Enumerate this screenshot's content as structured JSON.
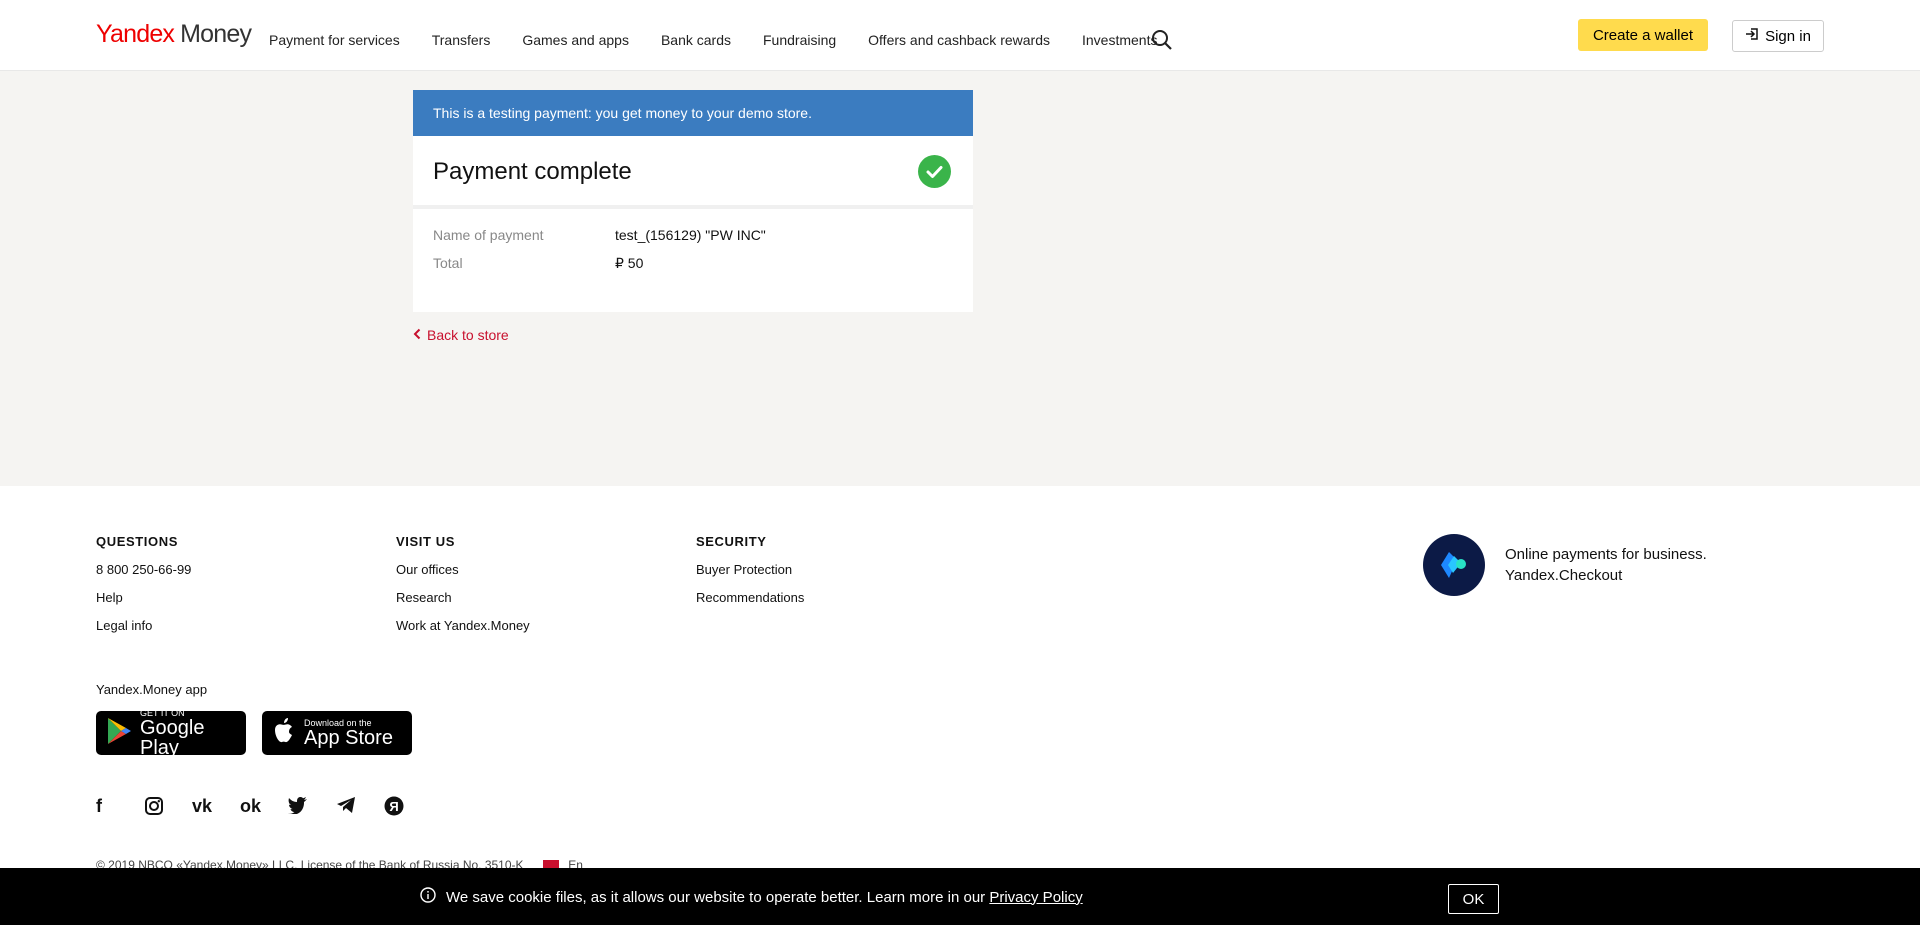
{
  "header": {
    "logo_yandex": "Yandex",
    "logo_money": "Money",
    "nav": [
      "Payment for services",
      "Transfers",
      "Games and apps",
      "Bank cards",
      "Fundraising",
      "Offers and cashback rewards",
      "Investments"
    ],
    "create_wallet": "Create a wallet",
    "sign_in": "Sign in"
  },
  "notice": "This is a testing payment: you get money to your demo store.",
  "card": {
    "title": "Payment complete",
    "rows": [
      {
        "label": "Name of payment",
        "value": "test_(156129) \"PW INC\""
      },
      {
        "label": "Total",
        "value": "₽ 50"
      }
    ]
  },
  "back_link": "Back to store",
  "footer": {
    "questions": {
      "title": "QUESTIONS",
      "items": [
        "8 800 250-66-99",
        "Help",
        "Legal info"
      ]
    },
    "visit": {
      "title": "VISIT US",
      "items": [
        "Our offices",
        "Research",
        "Work at Yandex.Money"
      ]
    },
    "security": {
      "title": "SECURITY",
      "items": [
        "Buyer Protection",
        "Recommendations"
      ]
    },
    "checkout_line1": "Online payments for business.",
    "checkout_line2": "Yandex.Checkout",
    "app_label": "Yandex.Money app",
    "google_small": "GET IT ON",
    "google_big": "Google Play",
    "apple_small": "Download on the",
    "apple_big": "App Store",
    "social_icons": [
      "facebook-icon",
      "instagram-icon",
      "vk-icon",
      "odnoklassniki-icon",
      "twitter-icon",
      "telegram-icon",
      "yandex-icon"
    ],
    "copyright": "© 2019 NBCO «Yandex.Money» LLC. License of the Bank of Russia No. 3510-K",
    "lang": "En"
  },
  "cookie": {
    "text": "We save cookie files, as it allows our website to operate better. Learn more in our",
    "link": "Privacy Policy",
    "ok": "OK"
  },
  "colors": {
    "accent_yellow": "#ffdb4d",
    "notice_blue": "#3b7cc0",
    "success_green": "#3ab44a",
    "link_red": "#c8102e"
  }
}
